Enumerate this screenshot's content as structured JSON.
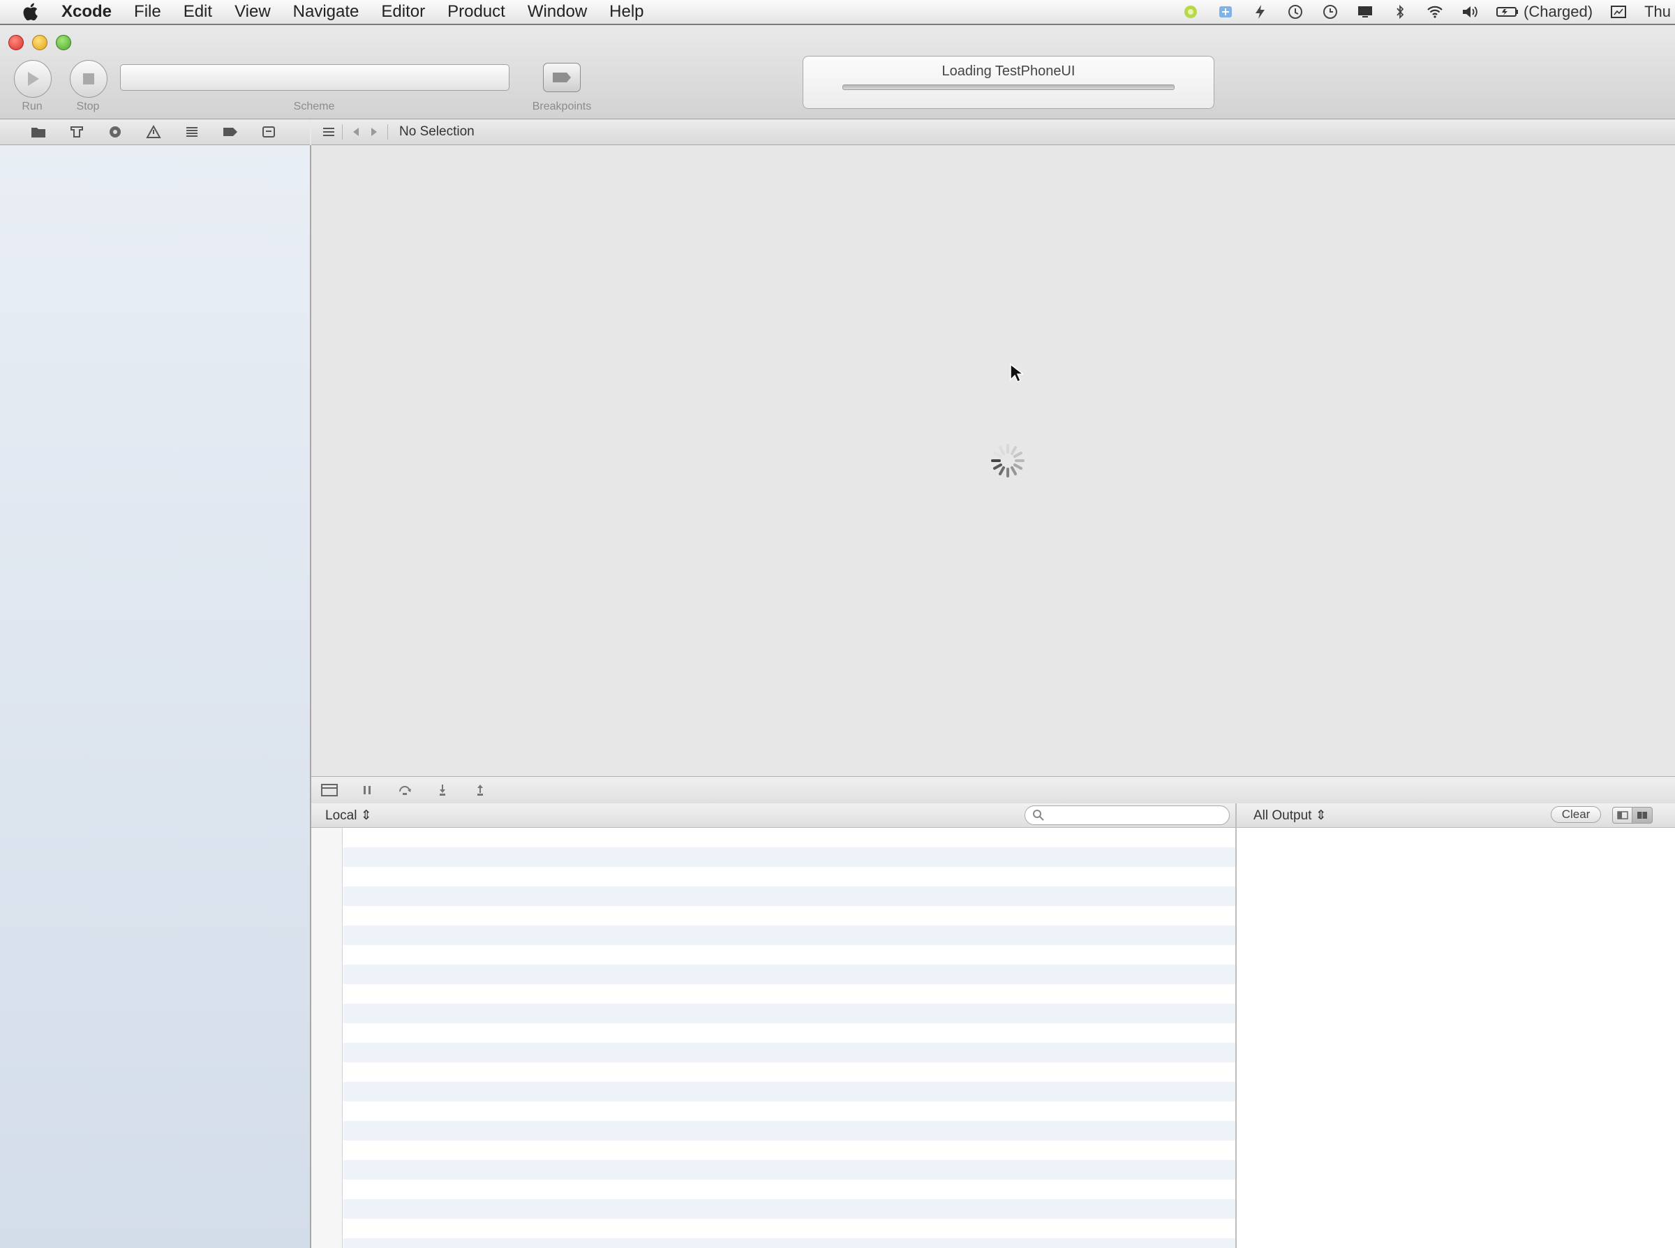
{
  "menubar": {
    "app_name": "Xcode",
    "items": [
      "File",
      "Edit",
      "View",
      "Navigate",
      "Editor",
      "Product",
      "Window",
      "Help"
    ],
    "battery_text": "(Charged)",
    "clock_text": "Thu"
  },
  "toolbar": {
    "run_caption": "Run",
    "stop_caption": "Stop",
    "scheme_caption": "Scheme",
    "breakpoints_caption": "Breakpoints",
    "activity_text": "Loading TestPhoneUI"
  },
  "jump_bar": {
    "selection_text": "No Selection"
  },
  "debug": {
    "variables_scope": "Local ⇕",
    "filter_placeholder": "",
    "console_scope": "All Output ⇕",
    "clear_label": "Clear"
  },
  "colors": {
    "menubar": "#ececec",
    "navigator": "#e2e8f0",
    "editor": "#e7e7e7",
    "row_stripe": "#eef3fa"
  }
}
